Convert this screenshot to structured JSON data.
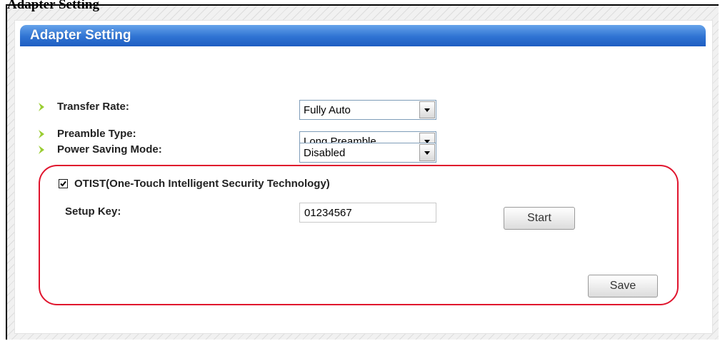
{
  "top_text": "Adapter Setting",
  "panel": {
    "title": "Adapter Setting"
  },
  "settings": {
    "transfer_rate": {
      "label": "Transfer Rate:",
      "value": "Fully Auto"
    },
    "preamble_type": {
      "label": "Preamble Type:",
      "value": "Long Preamble"
    },
    "power_saving_mode": {
      "label": "Power Saving Mode:",
      "value": "Disabled"
    }
  },
  "otist": {
    "checkbox_label": "OTIST(One-Touch Intelligent Security Technology)",
    "checked": true,
    "setup_key_label": "Setup Key:",
    "setup_key_value": "01234567",
    "start_button": "Start"
  },
  "save_button": "Save",
  "colors": {
    "header_blue": "#2f73d3",
    "bullet_green": "#9acd32",
    "highlight_red": "#e0142d"
  },
  "icons": {
    "bullet": "green-chevron-icon",
    "dropdown": "chevron-down-icon",
    "checkbox": "checkmark-icon"
  }
}
